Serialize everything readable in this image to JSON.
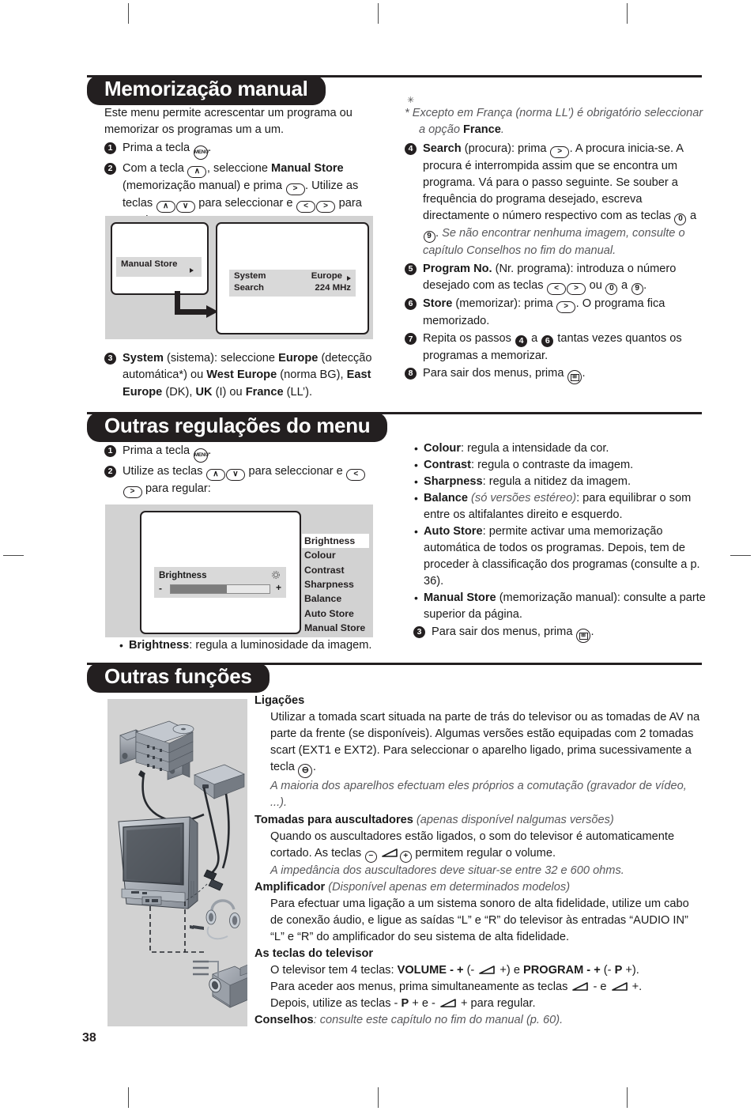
{
  "page": {
    "number": "38"
  },
  "sections": [
    {
      "id": "memorizacao-manual",
      "title": "Memorização manual",
      "left": {
        "intro": "Este menu permite acrescentar um programa ou memorizar os programas um a um.",
        "steps": [
          {
            "n": "1",
            "text_a": "Prima a tecla ",
            "key": "MENU",
            "text_b": "."
          },
          {
            "n": "2",
            "parts": "Com a tecla (∧), seleccione Manual Store (memorização manual) e prima (>). Utilize as teclas (∧)(∨) para seleccionar e (<)(>) para regular:"
          },
          {
            "n": "3",
            "parts": "System (sistema): seleccione Europe (detecção automática*) ou West Europe (norma BG), East Europe (DK), UK (I) ou France (LL')."
          }
        ],
        "screen1": {
          "menu_item": "Manual Store"
        },
        "screen2": {
          "rows": [
            {
              "label": "System",
              "value": "Europe"
            },
            {
              "label": "Search",
              "value": "224 MHz"
            }
          ]
        }
      },
      "right": {
        "footnote": "* Excepto em França (norma LL') é obrigatório seleccionar a opção France.",
        "footnote_bold": "France",
        "steps": [
          {
            "n": "4",
            "bold": "Search",
            "text": "(procura): prima (>). A procura inicia-se. A procura é interrompida assim que se encontra um programa. Vá para o passo seguinte. Se souber a frequência do programa desejado, escreva directamente o número respectivo com as teclas (0) a (9). Se não encontrar nenhuma imagem, consulte o capítulo Conselhos no fim do manual."
          },
          {
            "n": "5",
            "bold": "Program No.",
            "text": "(Nr. programa): introduza o número desejado com as teclas (<)(>) ou (0) a (9)."
          },
          {
            "n": "6",
            "bold": "Store",
            "text": "(memorizar): prima (>). O programa fica memorizado."
          },
          {
            "n": "7",
            "bold": "",
            "text": "Repita os passos 4 a 6 tantas vezes quantos os programas a memorizar."
          },
          {
            "n": "8",
            "bold": "",
            "text": "Para sair dos menus, prima [EXIT]."
          }
        ]
      }
    },
    {
      "id": "outras-regulacoes",
      "title": "Outras regulações do menu",
      "left": {
        "steps": [
          {
            "n": "1",
            "text": "Prima a tecla (MENU)."
          },
          {
            "n": "2",
            "text": "Utilize as teclas (∧)(∨) para seleccionar e (<)(>) para regular:"
          }
        ],
        "brightness_panel": {
          "title": "Brightness",
          "minus": "-",
          "plus": "+",
          "fill_percent": 57
        },
        "menu_list": [
          "Brightness",
          "Colour",
          "Contrast",
          "Sharpness",
          "Balance",
          "Auto Store",
          "Manual Store"
        ],
        "menu_list_selected": "Brightness",
        "caption_bold": "Brightness",
        "caption_rest": ": regula a luminosidade da imagem."
      },
      "right": {
        "bullets": [
          {
            "bold": "Colour",
            "text": ": regula a intensidade da cor."
          },
          {
            "bold": "Contrast",
            "text": ": regula o contraste da imagem."
          },
          {
            "bold": "Sharpness",
            "text": ": regula a nitidez da imagem."
          },
          {
            "bold": "Balance",
            "italic": " (só versões estéreo)",
            "text": ": para equilibrar o som entre os altifalantes direito e esquerdo."
          },
          {
            "bold": "Auto Store",
            "text": ": permite activar uma memorização automática de todos os programas. Depois, tem de proceder à classificação dos programas (consulte a p. 36)."
          },
          {
            "bold": "Manual Store",
            "text": " (memorização manual): consulte a parte superior da página."
          }
        ],
        "last_step": {
          "n": "3",
          "text": "Para sair dos menus, prima [EXIT]."
        }
      }
    },
    {
      "id": "outras-funcoes",
      "title": "Outras funções",
      "blocks": [
        {
          "heading": "Ligações",
          "body": "Utilizar a tomada scart situada na parte de trás do televisor ou as tomadas de AV na parte da frente (se disponíveis). Algumas versões estão equipadas com 2 tomadas scart (EXT1 e EXT2). Para seleccionar o aparelho ligado, prima sucessivamente a tecla (⊡).",
          "note": "A maioria dos aparelhos efectuam eles próprios a comutação (gravador de vídeo, ...)."
        },
        {
          "heading": "Tomadas para auscultadores",
          "heading_note": " (apenas disponível nalgumas versões)",
          "body": "Quando os auscultadores estão ligados, o som do televisor é automaticamente cortado. As teclas (−) ◿ (+) permitem regular o volume.",
          "note": "A impedância dos auscultadores deve situar-se entre 32 e 600 ohms."
        },
        {
          "heading": "Amplificador",
          "heading_note": " (Disponível apenas em determinados modelos)",
          "body": "Para efectuar uma ligação a um sistema sonoro de alta fidelidade, utilize um cabo de conexão áudio, e ligue as saídas “L” e “R” do televisor às entradas “AUDIO IN” “L” e “R” do amplificador do seu sistema de alta fidelidade.",
          "note": ""
        },
        {
          "heading": "As teclas do televisor",
          "heading_note": "",
          "body": "O televisor tem 4 teclas: VOLUME - + (- ◿ +) e PROGRAM - + (- P +). Para aceder aos menus, prima simultaneamente as teclas ◿ - e ◿ +. Depois, utilize as teclas - P + e - ◿ + para regular.",
          "note": ""
        }
      ],
      "advice_bold": "Conselhos",
      "advice_rest": ": consulte este capítulo no fim do manual (p. 60)."
    }
  ]
}
